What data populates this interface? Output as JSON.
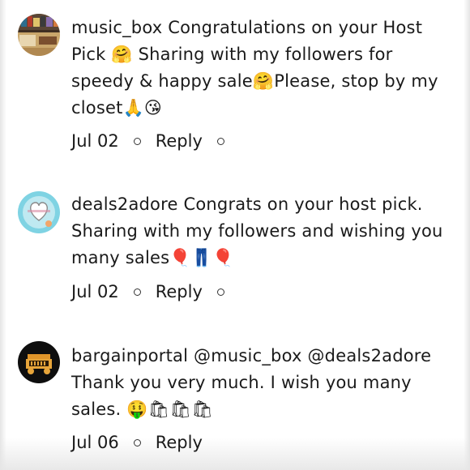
{
  "comments": [
    {
      "username": "music_box",
      "body": "Congratulations on your Host Pick 🤗 Sharing with my followers for speedy & happy sale🤗Please, stop by my closet🙏😘",
      "date": "Jul 02",
      "reply_label": "Reply"
    },
    {
      "username": "deals2adore",
      "body": "Congrats on your host pick. Sharing with my followers and wishing you many sales🎈👖🎈",
      "date": "Jul 02",
      "reply_label": "Reply"
    },
    {
      "username": "bargainportal",
      "body": "@music_box  @deals2adore Thank you very much.  I wish you many sales. 🤑🛍🛍🛍",
      "date": "Jul 06",
      "reply_label": "Reply"
    }
  ]
}
